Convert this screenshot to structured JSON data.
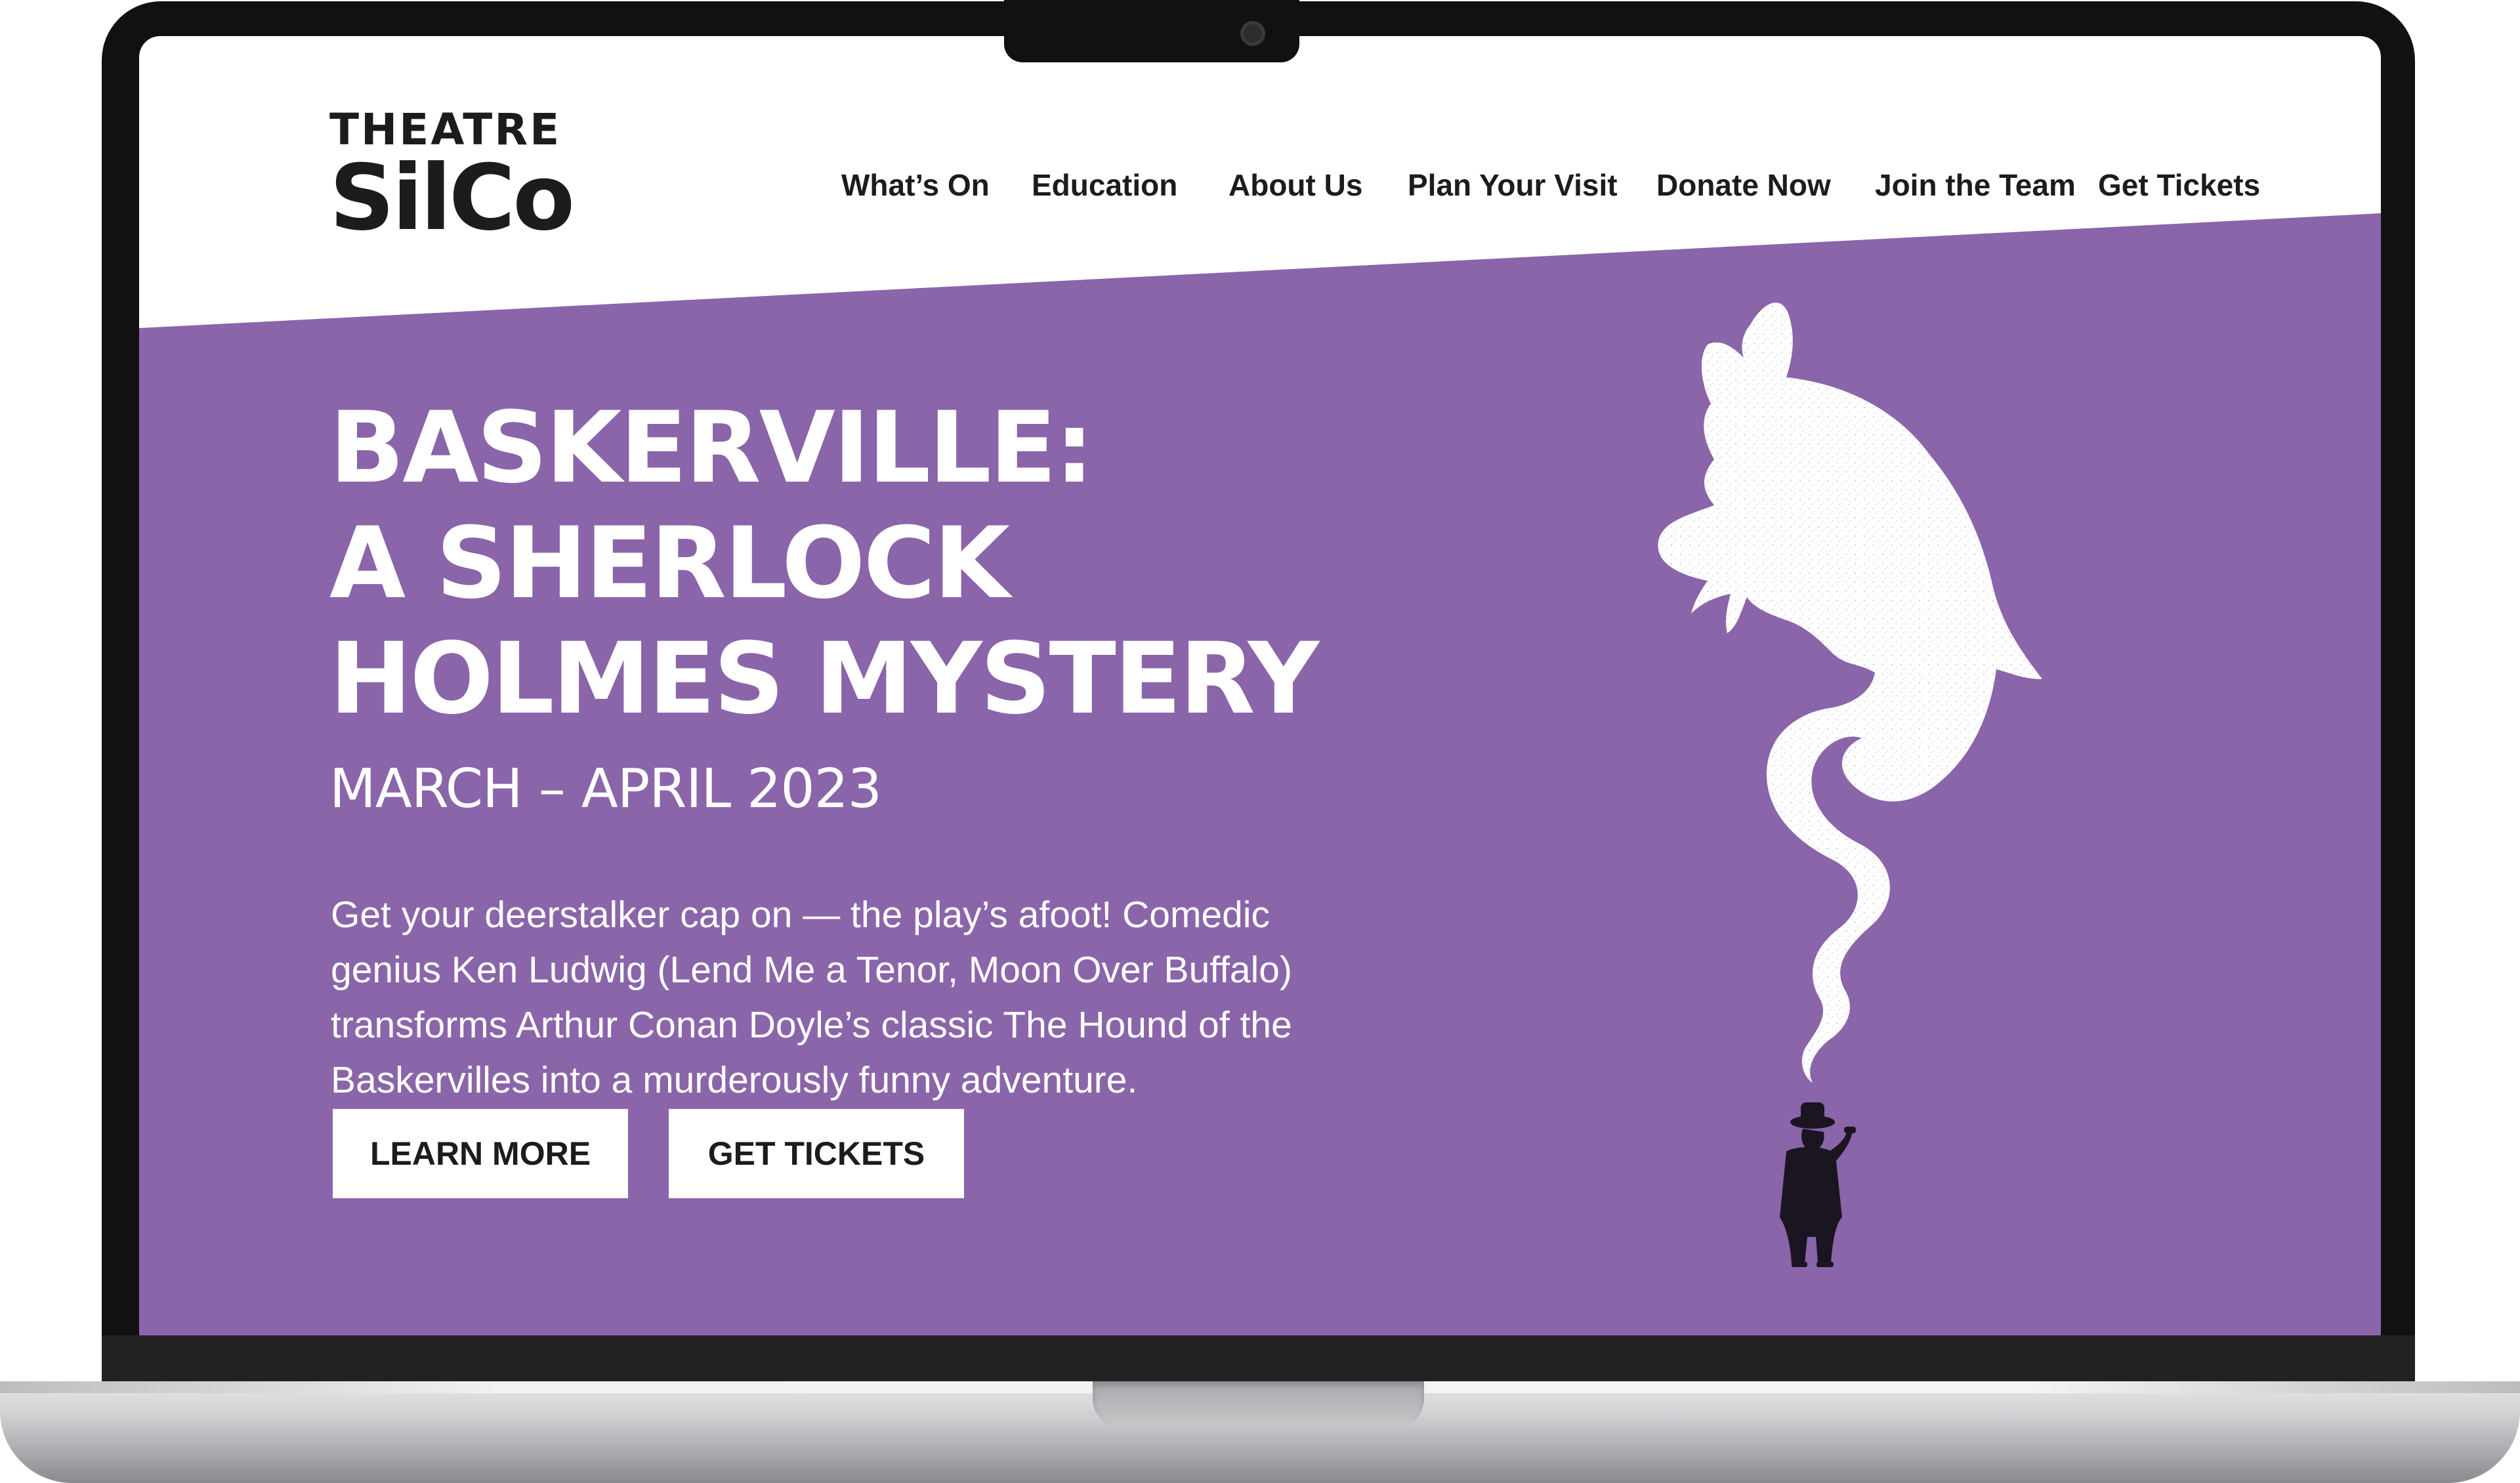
{
  "site": {
    "logo_top": "THEATRE",
    "logo_bottom": "SilCo"
  },
  "nav": {
    "items": [
      {
        "label": "What’s On"
      },
      {
        "label": "Education"
      },
      {
        "label": "About Us"
      },
      {
        "label": "Plan Your Visit"
      },
      {
        "label": "Donate Now"
      },
      {
        "label": "Join the Team"
      },
      {
        "label": "Get Tickets"
      }
    ]
  },
  "hero": {
    "title_line1": "BASKERVILLE:",
    "title_line2": "A SHERLOCK",
    "title_line3": "HOLMES MYSTERY",
    "dates": "MARCH – APRIL 2023",
    "description": "Get your deerstalker cap on — the play’s afoot! Comedic genius Ken Ludwig (Lend Me a Tenor, Moon Over Buffalo) transforms Arthur Conan Doyle’s classic The Hound of the Baskervilles into a murderously funny adventure.",
    "learn_more_label": "LEARN MORE",
    "get_tickets_label": "GET TICKETS"
  },
  "illustration": {
    "hound_icon": "hound-smoke-silhouette",
    "detective_icon": "detective-pipe-silhouette"
  },
  "colors": {
    "hero_purple": "#8a65aa",
    "text_dark": "#1c1c1c",
    "white": "#ffffff",
    "laptop_bezel": "#111111"
  }
}
